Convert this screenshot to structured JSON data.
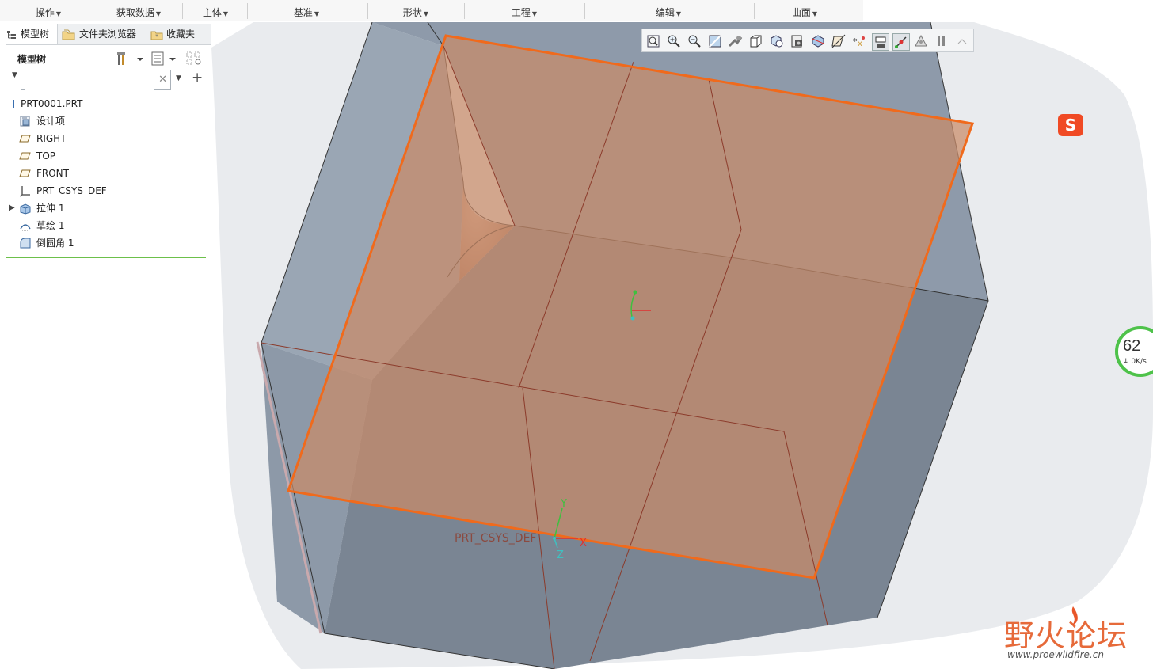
{
  "ribbon": {
    "groups": [
      "操作",
      "获取数据",
      "主体",
      "基准",
      "形状",
      "工程",
      "编辑",
      "曲面"
    ]
  },
  "left_panel": {
    "tabs": [
      "模型树",
      "文件夹浏览器",
      "收藏夹"
    ],
    "title": "模型树",
    "search": {
      "value": "",
      "placeholder": ""
    },
    "tree": [
      {
        "label": "PRT0001.PRT",
        "icon": "part-icon",
        "expandable": false
      },
      {
        "label": "设计项",
        "icon": "design-items-icon",
        "expandable": true
      },
      {
        "label": "RIGHT",
        "icon": "datum-plane-icon",
        "expandable": false
      },
      {
        "label": "TOP",
        "icon": "datum-plane-icon",
        "expandable": false
      },
      {
        "label": "FRONT",
        "icon": "datum-plane-icon",
        "expandable": false
      },
      {
        "label": "PRT_CSYS_DEF",
        "icon": "coordinate-system-icon",
        "expandable": false
      },
      {
        "label": "拉伸 1",
        "icon": "extrude-icon",
        "expandable": true
      },
      {
        "label": "草绘 1",
        "icon": "sketch-icon",
        "expandable": false
      },
      {
        "label": "倒圆角 1",
        "icon": "round-icon",
        "expandable": false
      }
    ]
  },
  "viewport": {
    "csys_label": "PRT_CSYS_DEF",
    "axis_labels": {
      "x": "X",
      "y": "Y",
      "z": "Z"
    },
    "plane_edge_color": "#f06a1c",
    "plane_fill_color": "#c98a68",
    "body_color": "#8a97a6"
  },
  "view_toolbar": {
    "icons": [
      "refit-icon",
      "zoom-in-icon",
      "zoom-out-icon",
      "repaint-icon",
      "perspective-icon",
      "display-style-icon",
      "saved-orientations-icon",
      "view-manager-icon",
      "section-icon",
      "datum-display-icon",
      "spin-center-icon",
      "annotation-display-icon",
      "plane-display-icon",
      "triangle-icon",
      "pause-icon"
    ]
  },
  "widgets": {
    "sogou_label": "S",
    "speed_value": "62",
    "speed_rate": "0K/s"
  },
  "watermark": {
    "title": "野火论坛",
    "url": "www.proewildfire.cn"
  }
}
